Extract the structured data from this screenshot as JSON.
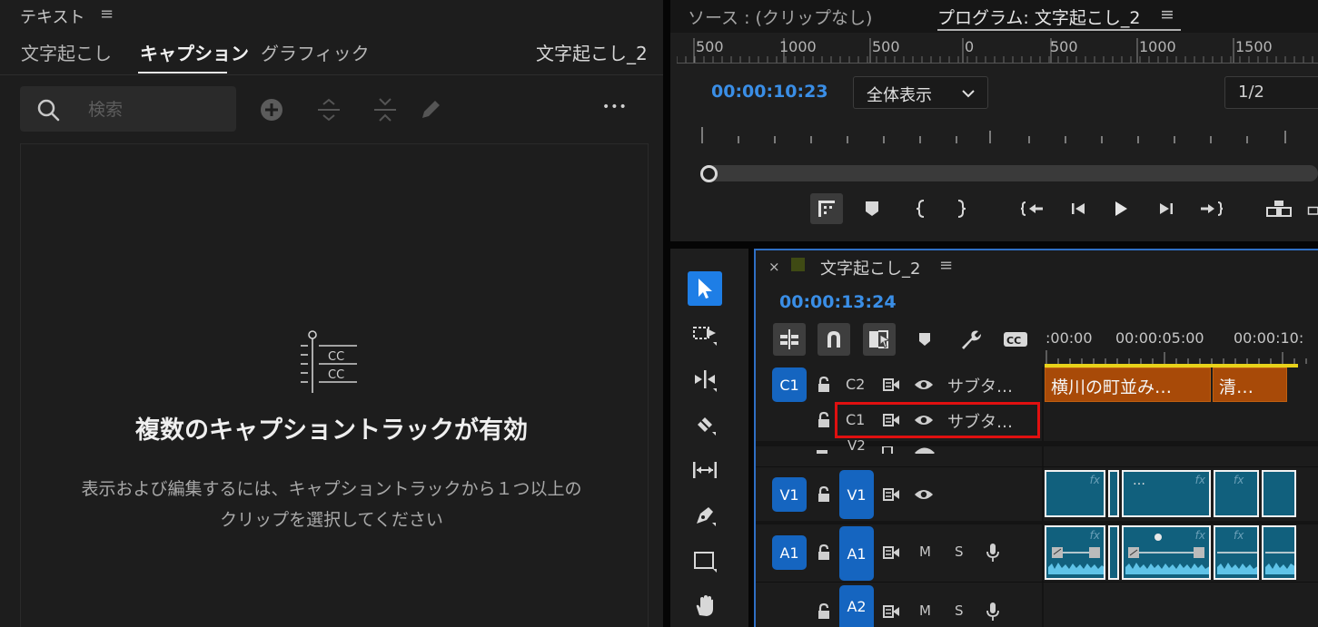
{
  "text_panel": {
    "title": "テキスト",
    "menu_glyph": "≡",
    "tabs": [
      {
        "label": "文字起こし"
      },
      {
        "label": "キャプション"
      },
      {
        "label": "グラフィック"
      }
    ],
    "sequence_name": "文字起こし_2",
    "search_placeholder": "検索",
    "empty_title": "複数のキャプショントラックが有効",
    "empty_desc_line1": "表示および編集するには、キャプショントラックから１つ以上の",
    "empty_desc_line2": "クリップを選択してください",
    "more_glyph": "•••"
  },
  "program_monitor": {
    "source_tab": "ソース : (クリップなし)",
    "program_tab": "プログラム: 文字起こし_2",
    "menu_glyph": "≡",
    "ruler_labels": [
      "500",
      "1000",
      "500",
      "0",
      "500",
      "1000",
      "1500"
    ],
    "timecode": "00:00:10:23",
    "zoom": "全体表示",
    "resolution": "1/2"
  },
  "timeline": {
    "close": "×",
    "name": "文字起こし_2",
    "menu_glyph": "≡",
    "timecode": "00:00:13:24",
    "ruler_times": [
      ":00:00",
      "00:00:05:00",
      "00:00:10:"
    ],
    "tracks": {
      "c1_target": "C1",
      "c2_label": "C2",
      "c2_name": "サブタ…",
      "c1_label": "C1",
      "c1_name": "サブタ…",
      "v2_label": "V2",
      "v1_target": "V1",
      "v1_label": "V1",
      "a1_target": "A1",
      "a1_label": "A1",
      "a2_label": "A2",
      "m": "M",
      "s": "S"
    },
    "caption_clips": [
      "横川の町並み…",
      "清…"
    ],
    "fx_label": "fx",
    "dots": "…"
  },
  "colors": {
    "accent_blue": "#1565c0",
    "timecode_blue": "#3a8ee6",
    "caption_clip": "#a84a08",
    "video_clip": "#11607d",
    "highlight_red": "#e01010",
    "work_area": "#e8d21a"
  }
}
